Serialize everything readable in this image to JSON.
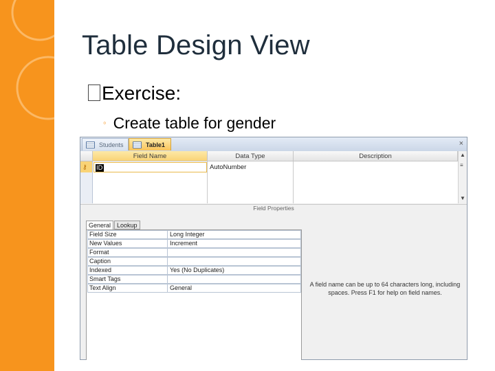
{
  "slide": {
    "title": "Table Design View",
    "bullet1": "Exercise:",
    "bullet2": "Create table for gender"
  },
  "access": {
    "tabs": [
      {
        "label": "Students",
        "active": false
      },
      {
        "label": "Table1",
        "active": true
      }
    ],
    "close_glyph": "×",
    "columns": [
      "Field Name",
      "Data Type",
      "Description"
    ],
    "row": {
      "field_name": "ID",
      "data_type": "AutoNumber",
      "description": ""
    },
    "field_properties_label": "Field Properties",
    "property_tabs": [
      "General",
      "Lookup"
    ],
    "properties": [
      {
        "label": "Field Size",
        "value": "Long Integer"
      },
      {
        "label": "New Values",
        "value": "Increment"
      },
      {
        "label": "Format",
        "value": ""
      },
      {
        "label": "Caption",
        "value": ""
      },
      {
        "label": "Indexed",
        "value": "Yes (No Duplicates)"
      },
      {
        "label": "Smart Tags",
        "value": ""
      },
      {
        "label": "Text Align",
        "value": "General"
      }
    ],
    "help_text": "A field name can be up to 64 characters long, including spaces. Press F1 for help on field names."
  },
  "colors": {
    "accent": "#f7941d",
    "title": "#1f2e3c",
    "active_tab": "#f9c35a"
  }
}
